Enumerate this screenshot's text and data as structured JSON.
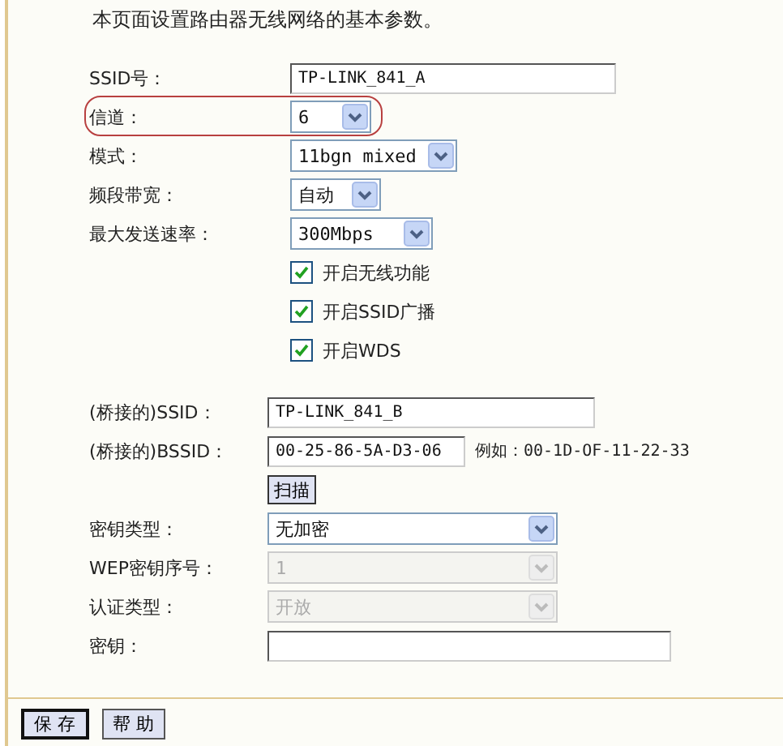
{
  "intro": "本页面设置路由器无线网络的基本参数。",
  "basic_rows": [
    {
      "kind": "text",
      "label": "SSID号：",
      "value": "TP-LINK_841_A"
    },
    {
      "kind": "select",
      "label": "信道：",
      "value": "6",
      "highlighted": true
    },
    {
      "kind": "select",
      "label": "模式：",
      "value": "11bgn mixed"
    },
    {
      "kind": "select",
      "label": "频段带宽：",
      "value": "自动"
    },
    {
      "kind": "select",
      "label": "最大发送速率：",
      "value": "300Mbps"
    },
    {
      "kind": "checkbox",
      "label": "开启无线功能",
      "checked": true
    },
    {
      "kind": "checkbox",
      "label": "开启SSID广播",
      "checked": true
    },
    {
      "kind": "checkbox",
      "label": "开启WDS",
      "checked": true
    }
  ],
  "wds_rows": [
    {
      "kind": "text",
      "label": "(桥接的)SSID：",
      "value": "TP-LINK_841_B"
    },
    {
      "kind": "text",
      "label": "(桥接的)BSSID：",
      "value": "00-25-86-5A-D3-06",
      "hint": "例如：00-1D-OF-11-22-33"
    },
    {
      "kind": "button",
      "label": "扫描"
    },
    {
      "kind": "select",
      "label": "密钥类型：",
      "value": "无加密",
      "disabled": false
    },
    {
      "kind": "select",
      "label": "WEP密钥序号：",
      "value": "1",
      "disabled": true
    },
    {
      "kind": "select",
      "label": "认证类型：",
      "value": "开放",
      "disabled": true
    },
    {
      "kind": "text",
      "label": "密钥："
    }
  ],
  "buttons": [
    {
      "label": "保 存",
      "selected": true
    },
    {
      "label": "帮 助",
      "selected": false
    }
  ]
}
